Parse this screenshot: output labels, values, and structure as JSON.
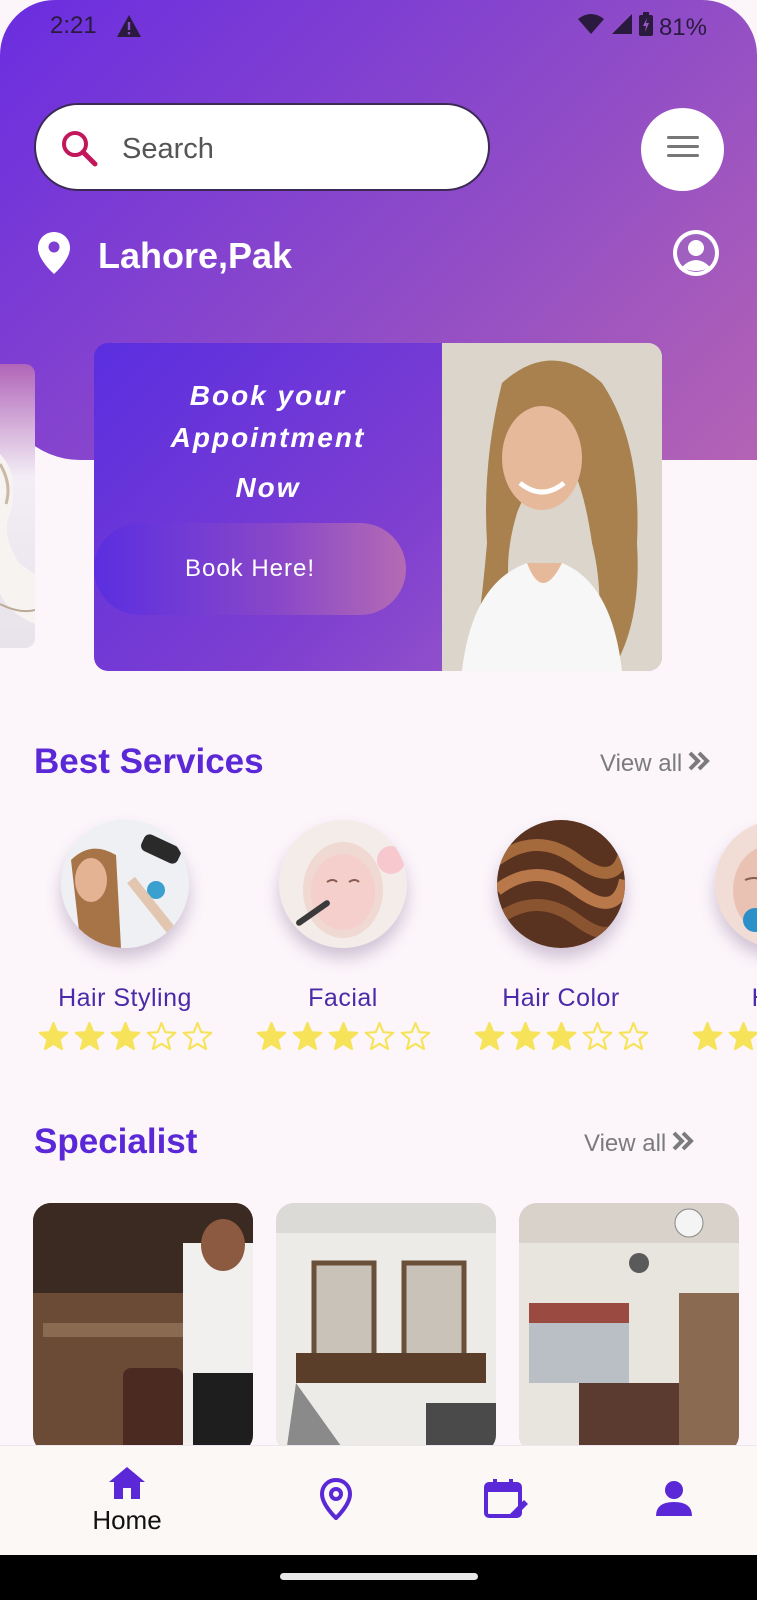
{
  "status_bar": {
    "time": "2:21",
    "battery": "81%"
  },
  "search": {
    "placeholder": "Search"
  },
  "location": {
    "city": "Lahore,Pak"
  },
  "banner": {
    "line1": "Book your",
    "line2": "Appointment",
    "line3": "Now",
    "button_label": "Book Here!"
  },
  "best_services": {
    "title": "Best Services",
    "view_all": "View all",
    "items": [
      {
        "name": "Hair Styling",
        "rating": 3,
        "max": 5
      },
      {
        "name": "Facial",
        "rating": 3,
        "max": 5
      },
      {
        "name": "Hair Color",
        "rating": 3,
        "max": 5
      },
      {
        "name": "Hydr",
        "rating": 3,
        "max": 5
      }
    ]
  },
  "specialist": {
    "title": "Specialist",
    "view_all": "View all"
  },
  "bottom_nav": {
    "home_label": "Home"
  },
  "colors": {
    "primary": "#5a28d6",
    "star": "#f7e35a",
    "header_gradient_start": "#6a2de0",
    "header_gradient_end": "#b463b4"
  },
  "icons": [
    "warning-icon",
    "wifi-icon",
    "signal-icon",
    "battery-icon",
    "search-icon",
    "menu-icon",
    "location-pin-icon",
    "user-avatar-icon",
    "chevron-double-right-icon",
    "star-icon",
    "home-icon",
    "map-pin-icon",
    "calendar-edit-icon",
    "person-icon"
  ]
}
